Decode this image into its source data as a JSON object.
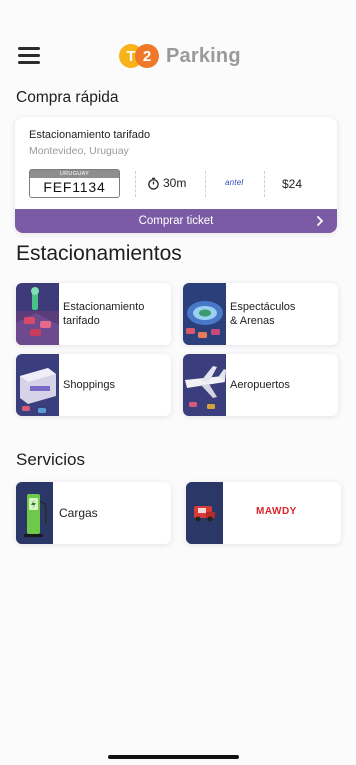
{
  "header": {
    "logo_t": "T",
    "logo_2": "2",
    "logo_text": "Parking"
  },
  "quick_purchase": {
    "title": "Compra rápida",
    "zone": "Estacionamiento tarifado",
    "city": "Montevideo, Uruguay",
    "plate_country": "URUGUAY",
    "plate": "FEF1134",
    "duration": "30m",
    "operator": "antel",
    "price": "$24",
    "buy_label": "Comprar ticket"
  },
  "parkings": {
    "title": "Estacionamientos",
    "items": [
      {
        "label": "Estacionamiento\ntarifado"
      },
      {
        "label": "Espectáculos\n& Arenas"
      },
      {
        "label": "Shoppings"
      },
      {
        "label": "Aeropuertos"
      }
    ]
  },
  "services": {
    "title": "Servicios",
    "items": [
      {
        "label": "Cargas"
      },
      {
        "label": "MAWDY"
      }
    ]
  },
  "colors": {
    "accent": "#7b5ba6",
    "logo_yellow": "#f7b21c",
    "logo_orange": "#f0782a"
  }
}
